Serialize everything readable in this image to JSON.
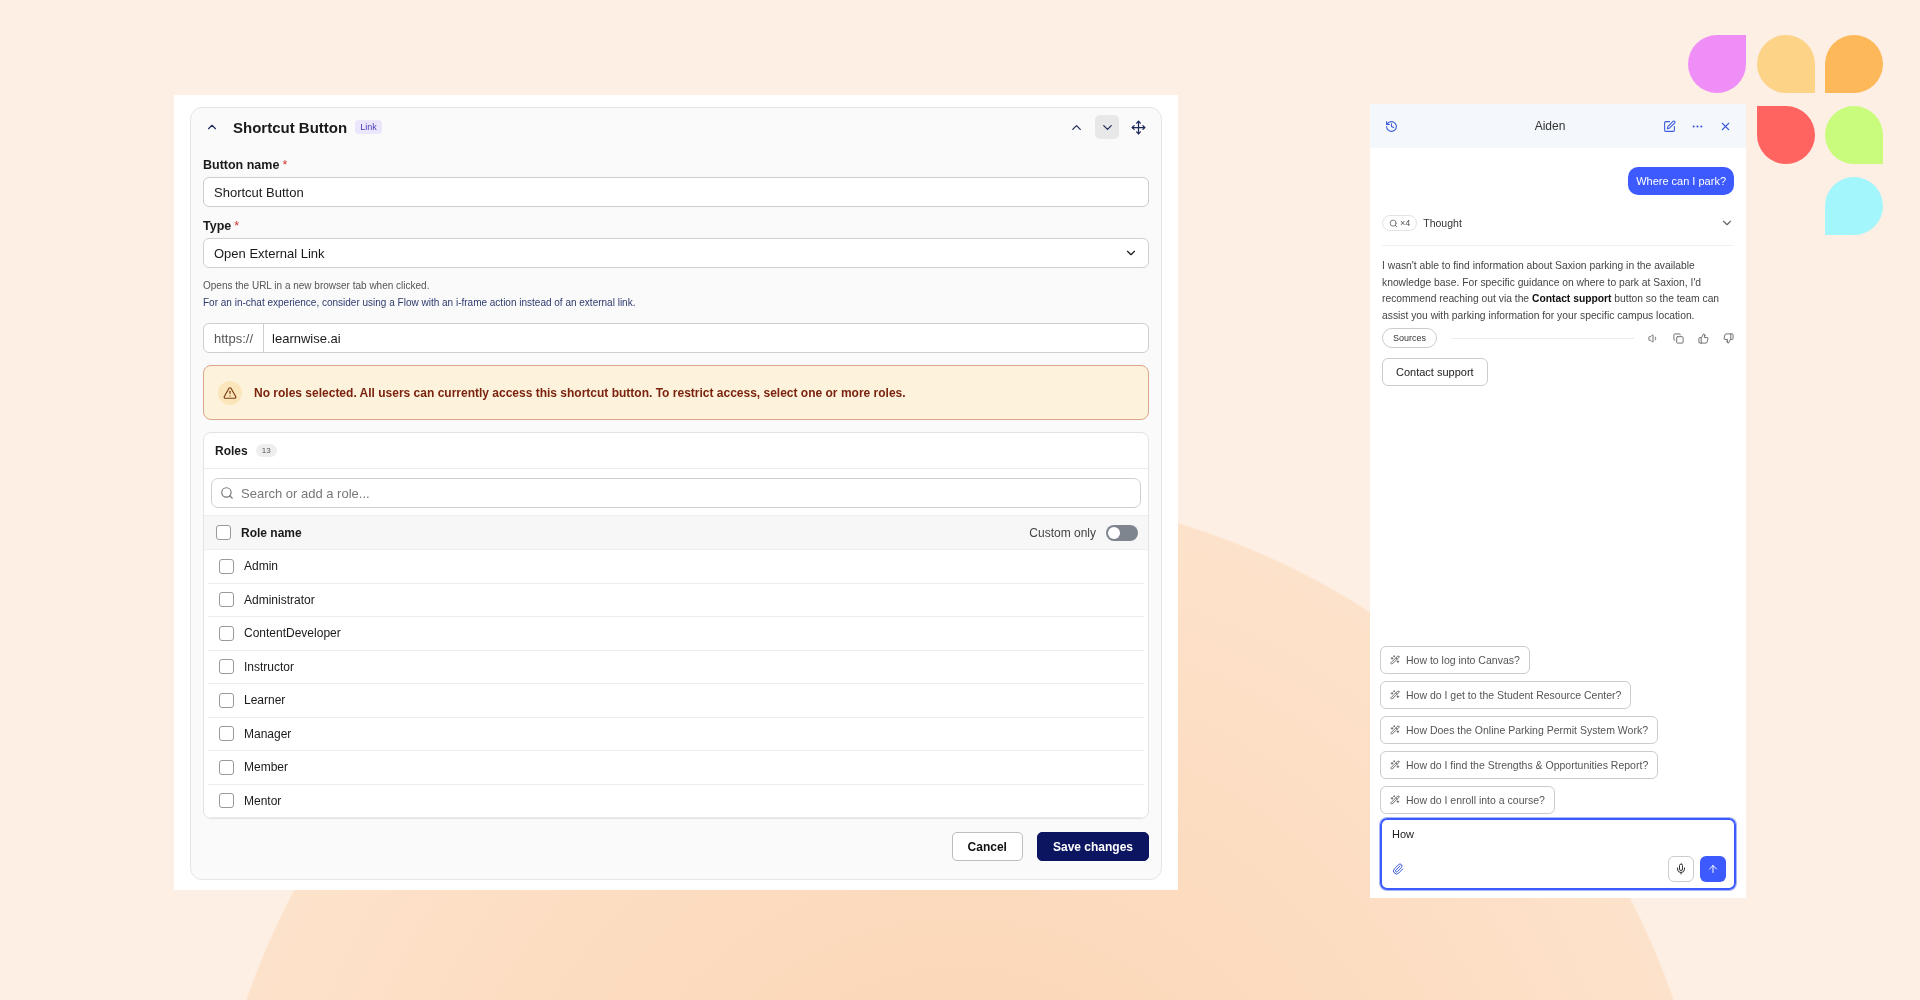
{
  "form": {
    "title": "Shortcut Button",
    "badge": "Link",
    "fields": [
      {
        "label": "Button name",
        "required_mark": "*",
        "value": "Shortcut Button",
        "kind": "text"
      },
      {
        "label": "Type",
        "required_mark": "*",
        "value": "Open External Link",
        "kind": "select"
      }
    ],
    "help": [
      "Opens the URL in a new browser tab when clicked.",
      "For an in-chat experience, consider using a Flow with an i-frame action instead of an external link."
    ],
    "url": {
      "prefix": "https://",
      "value": "learnwise.ai"
    },
    "warning": "No roles selected. All users can currently access this shortcut button. To restrict access, select one or more roles.",
    "roles": {
      "title": "Roles",
      "count": "13",
      "search_placeholder": "Search or add a role...",
      "column": "Role name",
      "select_all_checked": false,
      "custom_only": {
        "label": "Custom only",
        "on": false
      },
      "items": [
        {
          "name": "Admin",
          "checked": false
        },
        {
          "name": "Administrator",
          "checked": false
        },
        {
          "name": "ContentDeveloper",
          "checked": false
        },
        {
          "name": "Instructor",
          "checked": false
        },
        {
          "name": "Learner",
          "checked": false
        },
        {
          "name": "Manager",
          "checked": false
        },
        {
          "name": "Member",
          "checked": false
        },
        {
          "name": "Mentor",
          "checked": false
        }
      ]
    },
    "buttons": [
      {
        "label": "Cancel",
        "kind": "secondary"
      },
      {
        "label": "Save changes",
        "kind": "primary"
      }
    ]
  },
  "chat": {
    "title": "Aiden",
    "question": "Where can I park?",
    "thought": {
      "count": "×4",
      "label": "Thought",
      "expanded": false
    },
    "answer": "I wasn't able to find information about Saxion parking in the available knowledge base. For specific guidance on where to park at Saxion, I'd recommend reaching out via the **Contact support** button so the team can assist you with parking information for your specific campus location.",
    "sources": "Sources",
    "action": "Contact support",
    "suggestions": [
      "How to log into Canvas?",
      "How do I get to the Student Resource Center?",
      "How Does the Online Parking Permit System Work?",
      "How do I find the Strengths & Opportunities Report?",
      "How do I enroll into a course?"
    ],
    "input": {
      "value": "How"
    }
  }
}
